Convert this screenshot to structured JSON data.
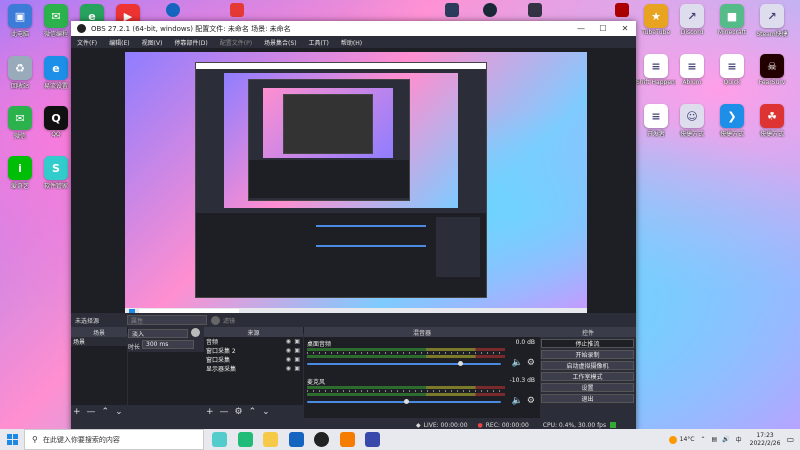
{
  "colors": {
    "obs_bg": "#2b2e38",
    "panel": "#1e1f24",
    "accent_slider": "#4a8ae0",
    "taskbar": "#e8e9ee"
  },
  "desktop_left": [
    {
      "label": "此电脑",
      "icon": "computer-icon",
      "color": "#3d7bd8",
      "glyph": "▣"
    },
    {
      "label": "微信编程",
      "icon": "wechat-program-icon",
      "color": "#2bb24c",
      "glyph": "✉"
    },
    {
      "label": "快捷方式",
      "icon": "edge-icon",
      "color": "#27a35e",
      "glyph": "e"
    },
    {
      "label": "快捷方式",
      "icon": "video-app-icon",
      "color": "#e33",
      "glyph": "▶"
    },
    {
      "label": "回收站",
      "icon": "recycle-bin-icon",
      "color": "#9ab",
      "glyph": "♻"
    },
    {
      "label": "易流设置",
      "icon": "browser-icon",
      "color": "#1e8fe8",
      "glyph": "e"
    },
    {
      "label": "微信",
      "icon": "wechat-icon",
      "color": "#2bb24c",
      "glyph": "✉"
    },
    {
      "label": "QQ",
      "icon": "qq-icon",
      "color": "#111",
      "glyph": "Q"
    },
    {
      "label": "爱奇艺",
      "icon": "iqiyi-icon",
      "color": "#00be06",
      "glyph": "i"
    },
    {
      "label": "软件管家",
      "icon": "software-icon",
      "color": "#3cc",
      "glyph": "S"
    }
  ],
  "desktop_right": [
    {
      "label": "TubeTube",
      "icon": "game-icon",
      "color": "#e8a320",
      "glyph": "★"
    },
    {
      "label": "Discord",
      "icon": "shortcut-icon",
      "color": "#dde",
      "glyph": "↗"
    },
    {
      "label": "Minecraft",
      "icon": "minecraft-icon",
      "color": "#5b8",
      "glyph": "■"
    },
    {
      "label": "Steam快捷",
      "icon": "steam-shortcut-icon",
      "color": "#dde",
      "glyph": "↗"
    },
    {
      "label": "Shift Happens",
      "icon": "document-icon",
      "color": "#fff",
      "glyph": "≡"
    },
    {
      "label": "Ablum",
      "icon": "document-icon",
      "color": "#fff",
      "glyph": "≡"
    },
    {
      "label": "Quick",
      "icon": "document-icon",
      "color": "#fff",
      "glyph": "≡"
    },
    {
      "label": "FearSurv",
      "icon": "fearsurv-icon",
      "color": "#200",
      "glyph": "☠"
    },
    {
      "label": "开发者",
      "icon": "document-icon",
      "color": "#fff",
      "glyph": "≡"
    },
    {
      "label": "快捷方式",
      "icon": "cat-icon",
      "color": "#dde",
      "glyph": "☺"
    },
    {
      "label": "快捷方式",
      "icon": "vscode-icon",
      "color": "#1e8fe8",
      "glyph": "❯"
    },
    {
      "label": "快捷方式",
      "icon": "app-icon",
      "color": "#d33",
      "glyph": "☘"
    }
  ],
  "obs": {
    "title": "OBS 27.2.1 (64-bit, windows)  配置文件: 未命名  场景: 未命名",
    "menu": [
      "文件(F)",
      "编辑(E)",
      "视图(V)",
      "停靠部件(D)",
      "配置文件(P)",
      "场景集合(S)",
      "工具(T)",
      "帮助(H)"
    ],
    "selection_bar": {
      "label": "未选择源",
      "btn1": "属性",
      "btn2": "滤镜"
    },
    "docks": {
      "scenes": {
        "header": "场景",
        "items": [
          "场景"
        ]
      },
      "transitions_row": {
        "type": "淡入",
        "duration_label": "时长",
        "duration": "300 ms"
      },
      "sources": {
        "header": "来源",
        "items": [
          "音频",
          "窗口采集 2",
          "窗口采集",
          "显示器采集"
        ]
      },
      "mixer": {
        "header": "混音器",
        "channels": [
          {
            "name": "桌面音频",
            "db": "0.0 dB",
            "level": 0.78
          },
          {
            "name": "麦克风",
            "db": "-10.3 dB",
            "level": 0.5
          }
        ]
      },
      "controls": {
        "header": "控件",
        "buttons": [
          "停止推流",
          "开始录制",
          "启动虚拟摄像机",
          "工作室模式",
          "设置",
          "退出"
        ]
      }
    },
    "status": {
      "live": "LIVE: 00:00:00",
      "rec": "REC: 00:00:00",
      "cpu": "CPU: 0.4%, 30.00 fps"
    }
  },
  "taskbar": {
    "search_placeholder": "在此键入你要搜索的内容",
    "weather": "14°C",
    "ime": "中",
    "time": "17:23",
    "date": "2022/2/26"
  }
}
